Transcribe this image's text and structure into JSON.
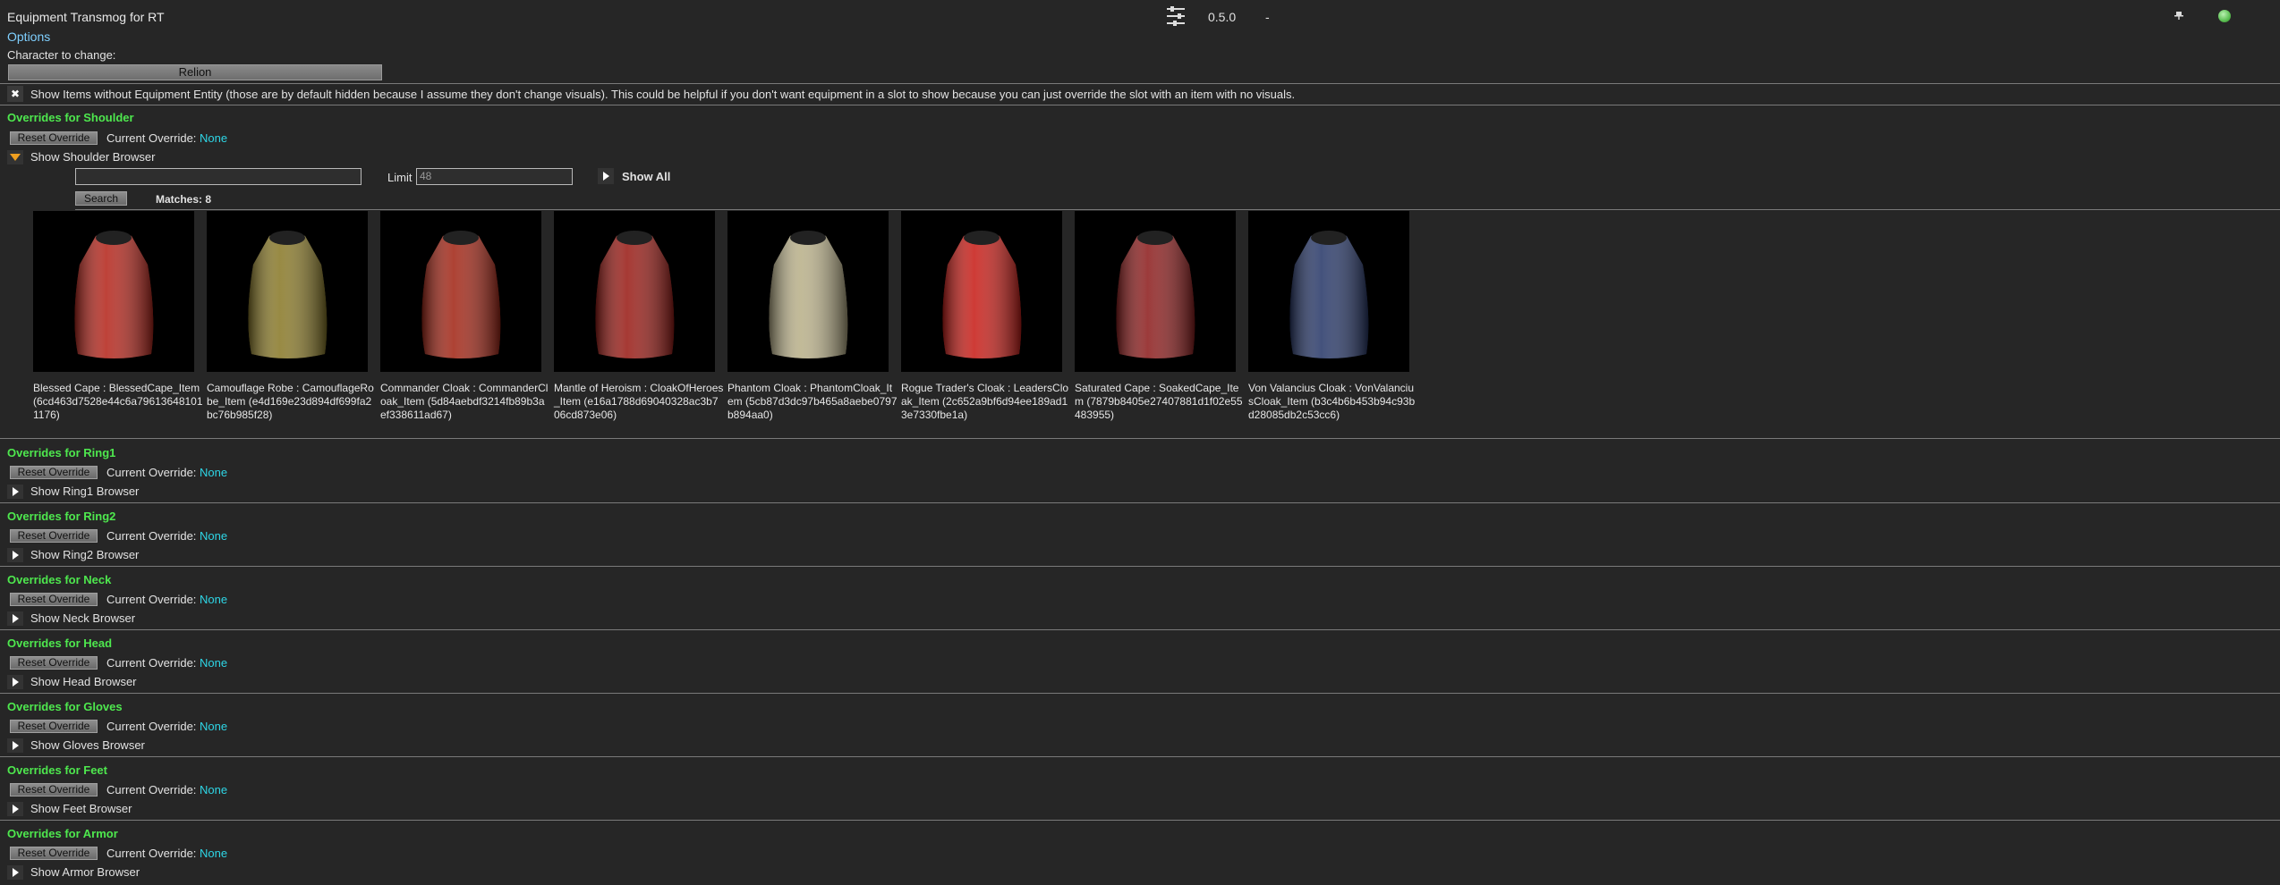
{
  "window": {
    "title": "Equipment Transmog for RT",
    "version": "0.5.0",
    "dash": "-"
  },
  "options_label": "Options",
  "character": {
    "label": "Character to change:",
    "selected": "Relion"
  },
  "show_items_toggle": {
    "checked": true,
    "label": "Show Items without Equipment Entity (those are by default hidden because I assume they don't change visuals). This could be helpful if you don't want equipment in a slot to show because you can just override the slot with an item with no visuals."
  },
  "reset_label": "Reset Override",
  "current_override_label": "Current Override:",
  "sections": [
    {
      "title": "Overrides for Shoulder",
      "override": "None",
      "browser_label": "Show Shoulder Browser",
      "expanded": true
    },
    {
      "title": "Overrides for Ring1",
      "override": "None",
      "browser_label": "Show Ring1 Browser",
      "expanded": false
    },
    {
      "title": "Overrides for Ring2",
      "override": "None",
      "browser_label": "Show Ring2 Browser",
      "expanded": false
    },
    {
      "title": "Overrides for Neck",
      "override": "None",
      "browser_label": "Show Neck Browser",
      "expanded": false
    },
    {
      "title": "Overrides for Head",
      "override": "None",
      "browser_label": "Show Head Browser",
      "expanded": false
    },
    {
      "title": "Overrides for Gloves",
      "override": "None",
      "browser_label": "Show Gloves Browser",
      "expanded": false
    },
    {
      "title": "Overrides for Feet",
      "override": "None",
      "browser_label": "Show Feet Browser",
      "expanded": false
    },
    {
      "title": "Overrides for Armor",
      "override": "None",
      "browser_label": "Show Armor Browser",
      "expanded": false
    }
  ],
  "browser": {
    "search_value": "",
    "limit_label": "Limit",
    "limit_value": "48",
    "show_all_label": "Show All",
    "search_button": "Search",
    "matches": "Matches: 8",
    "items": [
      {
        "name": "Blessed Cape : BlessedCape_Item (6cd463d7528e44c6a796136481011176)",
        "color": "#b5281e",
        "icon": "cape-icon"
      },
      {
        "name": "Camouflage Robe : CamouflageRobe_Item (e4d169e23d894df699fa2bc76b985f28)",
        "color": "#8a7a2a",
        "icon": "robe-icon"
      },
      {
        "name": "Commander Cloak : CommanderCloak_Item (5d84aebdf3214fb89b3aef338611ad67)",
        "color": "#a32818",
        "icon": "cloak-icon"
      },
      {
        "name": "Mantle of Heroism : CloakOfHeroes_Item (e16a1788d69040328ac3b706cd873e06)",
        "color": "#9a1e18",
        "icon": "mantle-icon"
      },
      {
        "name": "Phantom Cloak : PhantomCloak_Item (5cb87d3dc97b465a8aebe0797b894aa0)",
        "color": "#b9b08a",
        "icon": "cloak-icon"
      },
      {
        "name": "Rogue Trader's Cloak : LeadersCloak_Item (2c652a9bf6d94ee189ad13e7330fbe1a)",
        "color": "#c8201a",
        "icon": "cloak-icon"
      },
      {
        "name": "Saturated Cape : SoakedCape_Item (7879b8405e27407881d1f02e55483955)",
        "color": "#8e2020",
        "icon": "cape-icon"
      },
      {
        "name": "Von Valancius Cloak : VonValanciusCloak_Item (b3c4b6b453b94c93bd28085db2c53cc6)",
        "color": "#2a3a6a",
        "icon": "cloak-icon"
      }
    ]
  }
}
